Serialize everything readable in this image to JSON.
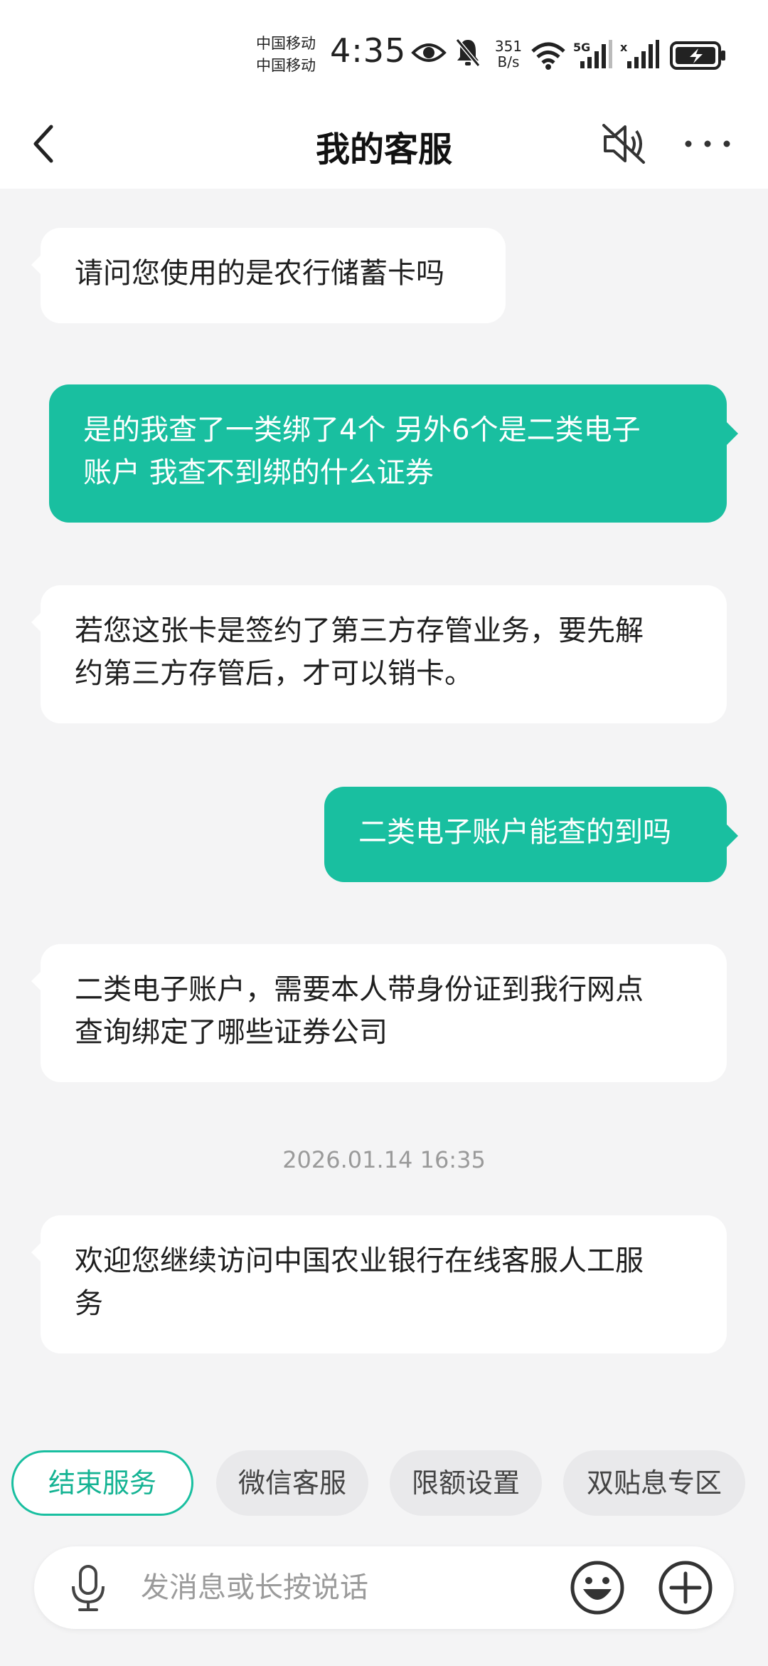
{
  "status_bar": {
    "carrier_1": "中国移动",
    "carrier_2": "中国移动",
    "time": "4:35",
    "speed_value": "351",
    "speed_unit": "B/s",
    "network": "5G",
    "icons": [
      "eye-icon",
      "bell-off-icon",
      "wifi-icon",
      "signal-icon",
      "battery-charging-icon"
    ]
  },
  "header": {
    "title": "我的客服",
    "icons": [
      "back-arrow-icon",
      "speaker-mute-icon",
      "more-icon"
    ]
  },
  "messages": [
    {
      "side": "agent",
      "text": "请问您使用的是农行储蓄卡吗"
    },
    {
      "side": "user",
      "line1": "是的我查了一类绑了4个 另外6个是二类电子",
      "line2": "账户 我查不到绑的什么证券"
    },
    {
      "side": "agent",
      "line1": "若您这张卡是签约了第三方存管业务，要先解",
      "line2": "约第三方存管后，才可以销卡。"
    },
    {
      "side": "user",
      "text": "二类电子账户能查的到吗"
    },
    {
      "side": "agent",
      "line1": "二类电子账户，需要本人带身份证到我行网点",
      "line2": "查询绑定了哪些证券公司"
    },
    {
      "side": "agent",
      "line1": "欢迎您继续访问中国农业银行在线客服人工服",
      "line2": "务"
    }
  ],
  "timestamp": "2026.01.14 16:35",
  "quick_replies": [
    "结束服务",
    "微信客服",
    "限额设置",
    "双贴息专区"
  ],
  "input": {
    "placeholder": "发消息或长按说话",
    "value": ""
  },
  "colors": {
    "accent": "#19bfa0",
    "background": "#f4f4f5",
    "bubble_agent": "#ffffff",
    "chip_bg": "#e9e9eb"
  }
}
